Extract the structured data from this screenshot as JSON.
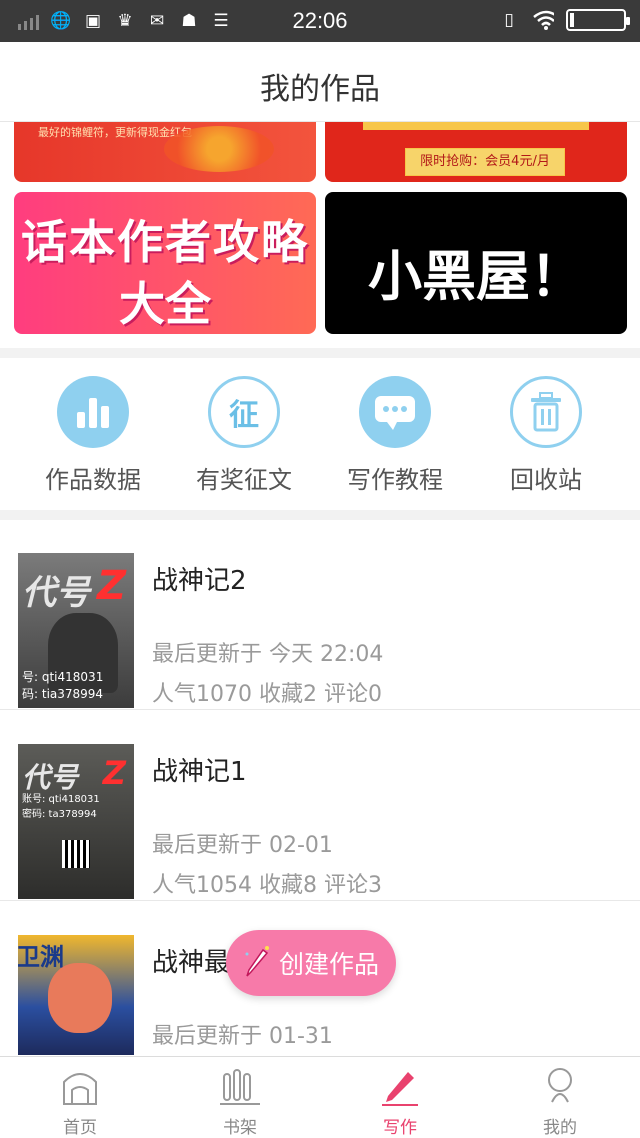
{
  "status_bar": {
    "time": "22:06"
  },
  "header": {
    "title": "我的作品"
  },
  "banners": [
    {
      "id": "lucky",
      "text": "最好的锦鲤符，更新得现金红包"
    },
    {
      "id": "vip",
      "text": "限时抢购：会员4元/月"
    },
    {
      "id": "guide",
      "line1": "话本作者攻略",
      "line2": "大全"
    },
    {
      "id": "darkroom",
      "line1": "小黑屋！"
    }
  ],
  "quick_actions": [
    {
      "label": "作品数据",
      "icon": "bar-chart-icon"
    },
    {
      "label": "有奖征文",
      "icon": "contest-icon"
    },
    {
      "label": "写作教程",
      "icon": "chat-bubble-icon"
    },
    {
      "label": "回收站",
      "icon": "trash-icon"
    }
  ],
  "works": [
    {
      "title": "战神记2",
      "updated": "最后更新于 今天 22:04",
      "stats": "人气1070 收藏2 评论0",
      "cover_title": "代号",
      "cover_meta1": "号: qti418031",
      "cover_meta2": "码: tia378994"
    },
    {
      "title": "战神记1",
      "updated": "最后更新于 02-01",
      "stats": "人气1054 收藏8 评论3",
      "cover_title": "代号",
      "cover_meta1": "账号: qti418031",
      "cover_meta2": "密码: ta378994"
    },
    {
      "title": "战神最",
      "updated": "最后更新于 01-31",
      "stats": "",
      "cover_title": "卫渊",
      "cover_meta1": "",
      "cover_meta2": ""
    }
  ],
  "fab": {
    "label": "创建作品",
    "icon": "pencil-icon"
  },
  "tabs": [
    {
      "label": "首页",
      "icon": "home-icon",
      "active": false
    },
    {
      "label": "书架",
      "icon": "bookshelf-icon",
      "active": false
    },
    {
      "label": "写作",
      "icon": "pencil-icon",
      "active": true
    },
    {
      "label": "我的",
      "icon": "profile-icon",
      "active": false
    }
  ],
  "colors": {
    "accent": "#e9426e",
    "fab": "#f77aa9",
    "quick_icon": "#8fd0ef",
    "status_bar": "#3a3a3a"
  }
}
